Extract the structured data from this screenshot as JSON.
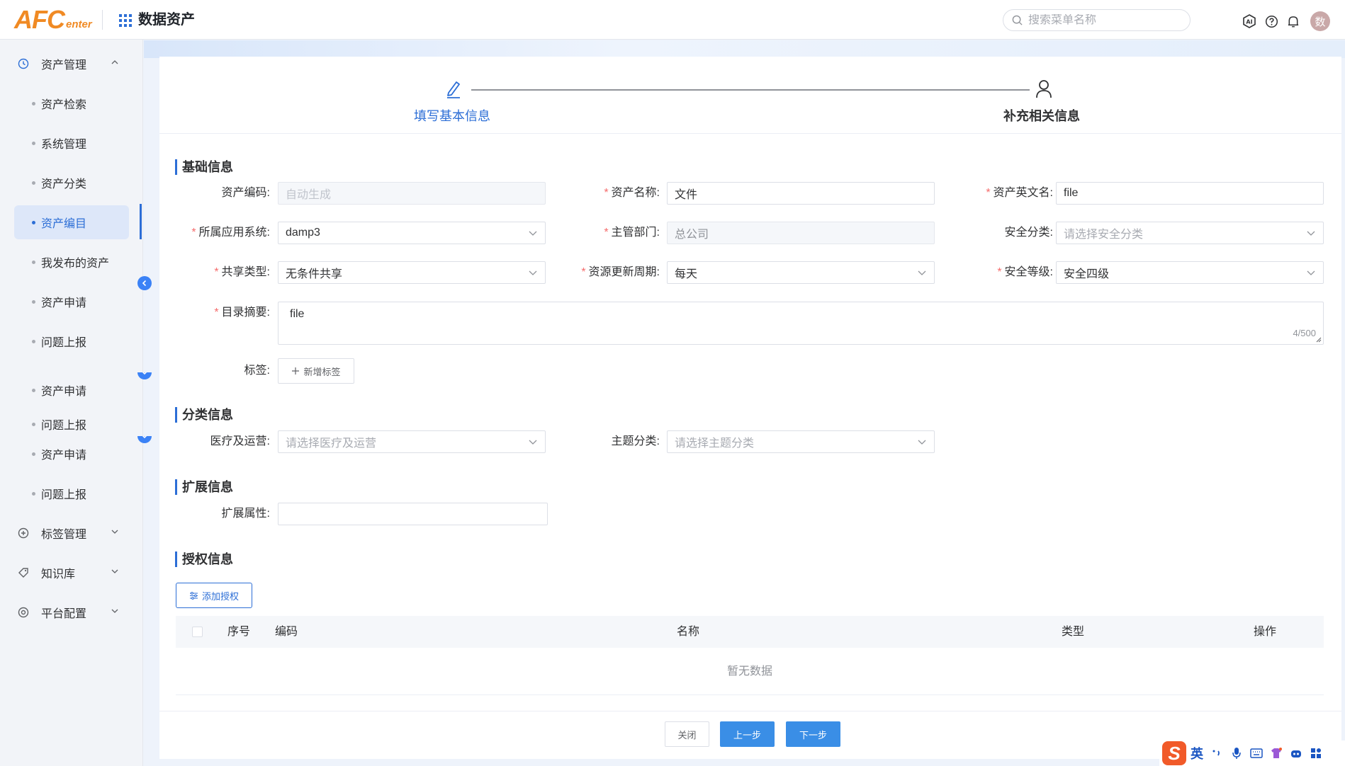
{
  "header": {
    "logo_main": "AFC",
    "logo_sub": "enter",
    "app_title": "数据资产",
    "search_placeholder": "搜索菜单名称",
    "avatar_text": "数"
  },
  "sidebar": {
    "groups": [
      {
        "label": "资产管理"
      },
      {
        "label": "标签管理"
      },
      {
        "label": "知识库"
      },
      {
        "label": "平台配置"
      }
    ],
    "items": [
      {
        "label": "资产检索"
      },
      {
        "label": "系统管理"
      },
      {
        "label": "资产分类"
      },
      {
        "label": "资产编目"
      },
      {
        "label": "我发布的资产"
      },
      {
        "label": "资产申请"
      },
      {
        "label": "问题上报"
      },
      {
        "label": "资产申请"
      },
      {
        "label": "问题上报"
      },
      {
        "label": "资产申请"
      },
      {
        "label": "问题上报"
      }
    ]
  },
  "steps": [
    {
      "label": "填写基本信息"
    },
    {
      "label": "补充相关信息"
    }
  ],
  "sections": {
    "basic": "基础信息",
    "category": "分类信息",
    "extend": "扩展信息",
    "auth": "授权信息"
  },
  "form": {
    "asset_code": {
      "label": "资产编码:",
      "placeholder": "自动生成"
    },
    "asset_name": {
      "label": "资产名称:",
      "value": "文件"
    },
    "asset_en_name": {
      "label": "资产英文名:",
      "value": "file"
    },
    "app_system": {
      "label": "所属应用系统:",
      "value": "damp3"
    },
    "dept": {
      "label": "主管部门:",
      "value": "总公司"
    },
    "security_class": {
      "label": "安全分类:",
      "placeholder": "请选择安全分类"
    },
    "share_type": {
      "label": "共享类型:",
      "value": "无条件共享"
    },
    "update_cycle": {
      "label": "资源更新周期:",
      "value": "每天"
    },
    "security_level": {
      "label": "安全等级:",
      "value": "安全四级"
    },
    "summary": {
      "label": "目录摘要:",
      "value": "file",
      "count": "4/500"
    },
    "tags": {
      "label": "标签:",
      "button": "新增标签"
    },
    "medical": {
      "label": "医疗及运营:",
      "placeholder": "请选择医疗及运营"
    },
    "theme": {
      "label": "主题分类:",
      "placeholder": "请选择主题分类"
    },
    "ext_attr": {
      "label": "扩展属性:",
      "value": ""
    }
  },
  "auth": {
    "add_button": "添加授权",
    "columns": [
      "序号",
      "编码",
      "名称",
      "类型",
      "操作"
    ],
    "empty": "暂无数据"
  },
  "footer": {
    "close": "关闭",
    "prev": "上一步",
    "next": "下一步"
  },
  "ime": {
    "lang": "英"
  },
  "colors": {
    "primary": "#2c6ed6",
    "logo": "#f08a24",
    "required": "#f56c6c"
  }
}
